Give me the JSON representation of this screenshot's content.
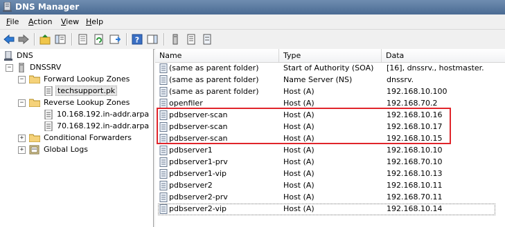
{
  "window": {
    "title": "DNS Manager"
  },
  "menu": {
    "file": {
      "key": "F",
      "rest": "ile"
    },
    "action": {
      "key": "A",
      "rest": "ction"
    },
    "view": {
      "key": "V",
      "rest": "iew"
    },
    "help": {
      "key": "H",
      "rest": "elp"
    }
  },
  "toolbar": {
    "buttons": [
      "back-icon",
      "forward-icon",
      "up-folder-icon",
      "show-hide-tree-icon",
      "properties-icon",
      "refresh-icon",
      "export-list-icon",
      "help-icon",
      "action-pane-icon",
      "server-icon",
      "zone-icon",
      "record-icon"
    ]
  },
  "tree": {
    "root": "DNS",
    "server": "DNSSRV",
    "forward_zones": "Forward Lookup Zones",
    "forward_zone_child": "techsupport.pk",
    "reverse_zones": "Reverse Lookup Zones",
    "reverse_child_1": "10.168.192.in-addr.arpa",
    "reverse_child_2": "70.168.192.in-addr.arpa",
    "conditional_forwarders": "Conditional Forwarders",
    "global_logs": "Global Logs",
    "expand_collapsed": "+",
    "expand_open": "−"
  },
  "list": {
    "columns": {
      "name": "Name",
      "type": "Type",
      "data": "Data"
    },
    "rows": [
      {
        "name": "(same as parent folder)",
        "type": "Start of Authority (SOA)",
        "data": "[16], dnssrv., hostmaster."
      },
      {
        "name": "(same as parent folder)",
        "type": "Name Server (NS)",
        "data": "dnssrv."
      },
      {
        "name": "(same as parent folder)",
        "type": "Host (A)",
        "data": "192.168.10.100"
      },
      {
        "name": "openfiler",
        "type": "Host (A)",
        "data": "192.168.70.2"
      },
      {
        "name": "pdbserver-scan",
        "type": "Host (A)",
        "data": "192.168.10.16"
      },
      {
        "name": "pdbserver-scan",
        "type": "Host (A)",
        "data": "192.168.10.17"
      },
      {
        "name": "pdbserver-scan",
        "type": "Host (A)",
        "data": "192.168.10.15"
      },
      {
        "name": "pdbserver1",
        "type": "Host (A)",
        "data": "192.168.10.10"
      },
      {
        "name": "pdbserver1-prv",
        "type": "Host (A)",
        "data": "192.168.70.10"
      },
      {
        "name": "pdbserver1-vip",
        "type": "Host (A)",
        "data": "192.168.10.13"
      },
      {
        "name": "pdbserver2",
        "type": "Host (A)",
        "data": "192.168.10.11"
      },
      {
        "name": "pdbserver2-prv",
        "type": "Host (A)",
        "data": "192.168.70.11"
      },
      {
        "name": "pdbserver2-vip",
        "type": "Host (A)",
        "data": "192.168.10.14"
      }
    ]
  },
  "colors": {
    "annotation_box": "#e0242a",
    "titlebar": "#4a6b93"
  }
}
